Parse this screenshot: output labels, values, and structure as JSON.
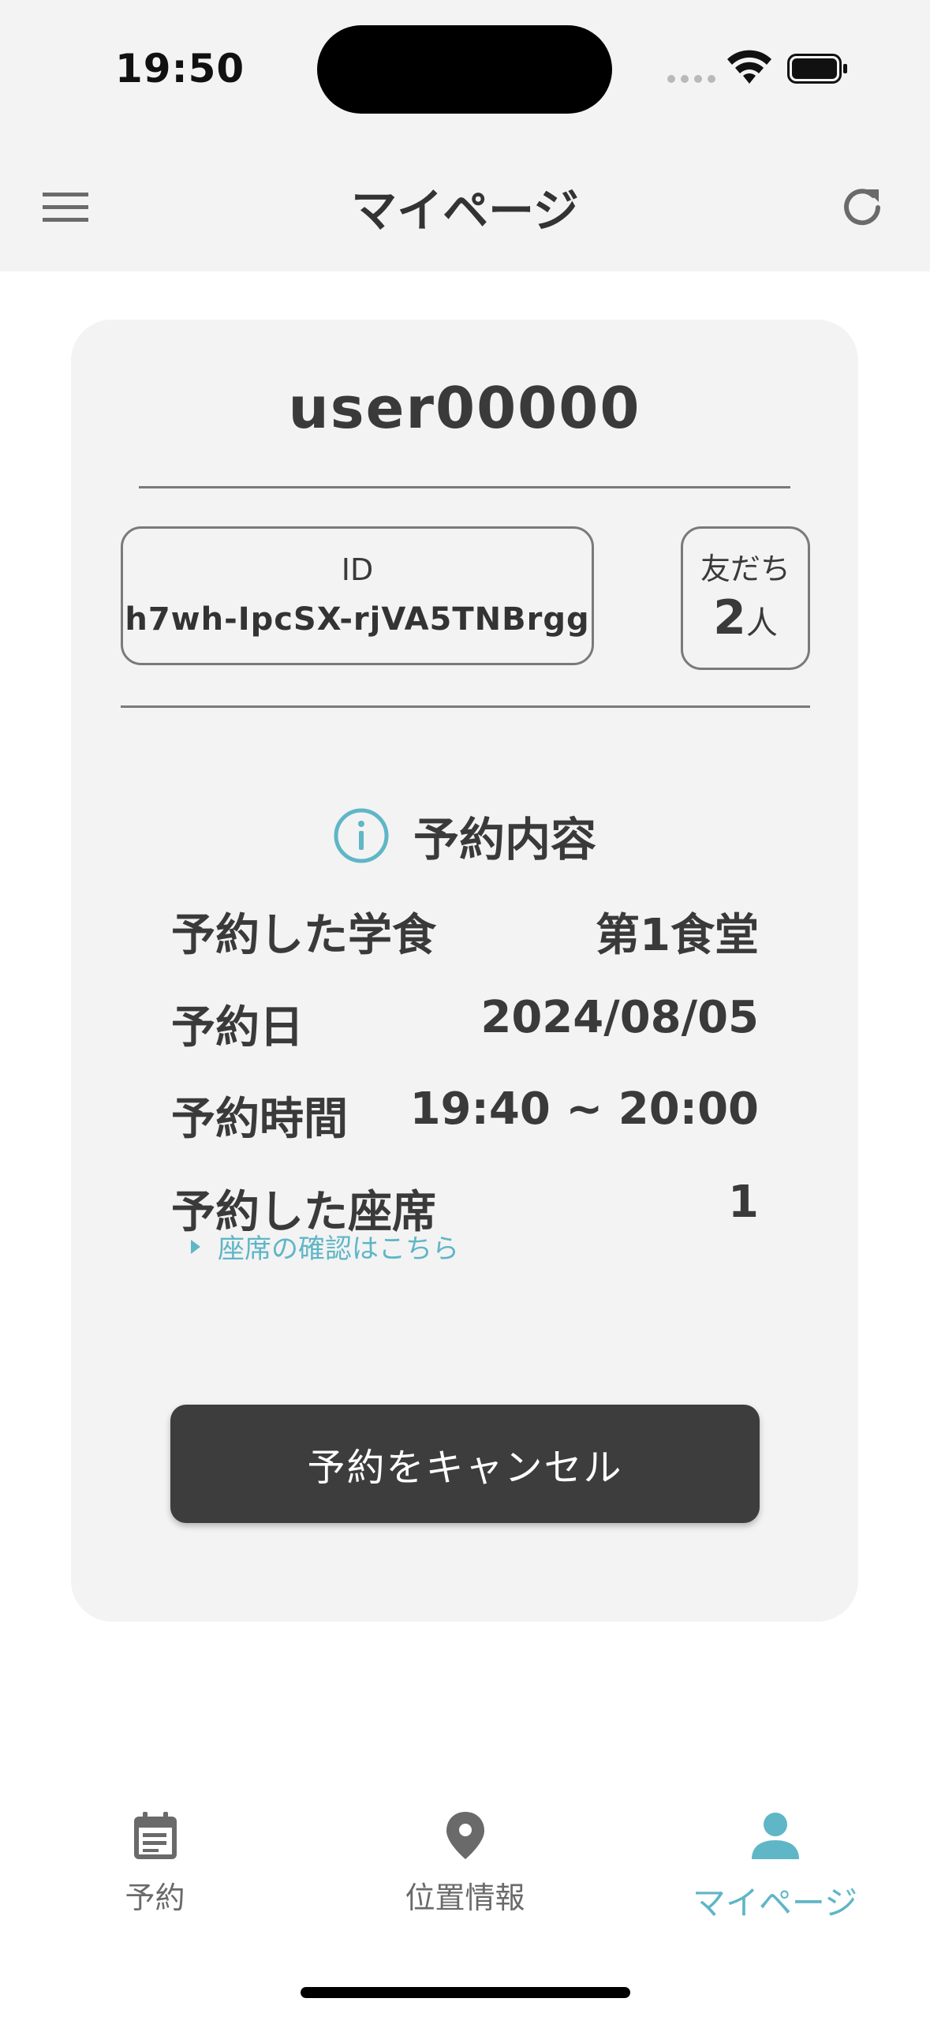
{
  "status_bar": {
    "time": "19:50"
  },
  "header": {
    "title": "マイページ",
    "menu_icon": "menu-icon",
    "refresh_icon": "refresh-icon"
  },
  "profile": {
    "username": "user00000",
    "id_label": "ID",
    "id_value": "h7wh-IpcSX-rjVA5TNBrgg",
    "friends_label": "友だち",
    "friends_count": "2",
    "friends_unit": "人"
  },
  "reservation": {
    "title": "予約内容",
    "icon": "info-icon",
    "rows": [
      {
        "label": "予約した学食",
        "value": "第1食堂"
      },
      {
        "label": "予約日",
        "value": "2024/08/05"
      },
      {
        "label": "予約時間",
        "value": "19:40 ~ 20:00"
      },
      {
        "label": "予約した座席",
        "value": "1"
      }
    ],
    "seat_link": "座席の確認はこちら",
    "cancel_label": "予約をキャンセル"
  },
  "tabs": [
    {
      "label": "予約",
      "icon": "calendar-icon",
      "active": false
    },
    {
      "label": "位置情報",
      "icon": "location-pin-icon",
      "active": false
    },
    {
      "label": "マイページ",
      "icon": "person-icon",
      "active": true
    }
  ],
  "colors": {
    "accent": "#5fb6c6",
    "button": "#3d3d3d",
    "surface": "#f3f3f3"
  }
}
